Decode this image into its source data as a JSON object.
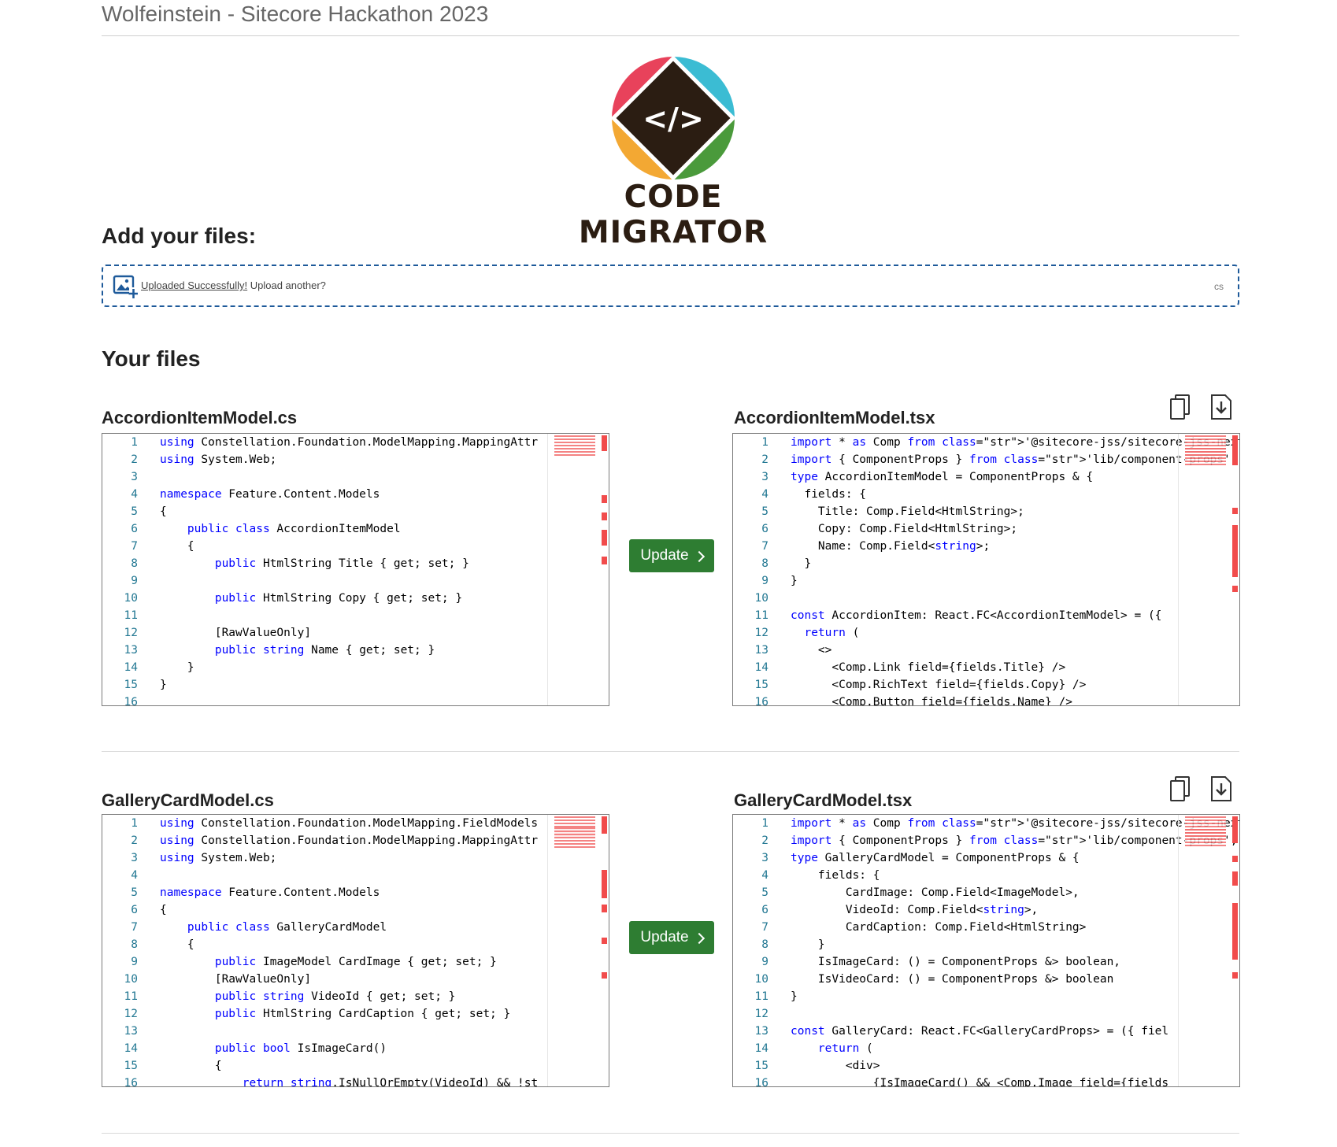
{
  "header": {
    "title": "Wolfeinstein - Sitecore Hackathon 2023"
  },
  "logo": {
    "text": "CODE MIGRATOR",
    "glyph": "</>",
    "colors": [
      "#e8425b",
      "#3bbcd3",
      "#f3a833",
      "#4a9a3b",
      "#2b1d12"
    ]
  },
  "upload": {
    "heading": "Add your files:",
    "link_text": "Uploaded Successfully!",
    "trailing_text": " Upload another?",
    "extension": "cs",
    "icon": "image-upload-icon"
  },
  "files_heading": "Your files",
  "update_label": "Update",
  "colors": {
    "accent": "#2e7d32",
    "dashed_border": "#1e5a9a",
    "error": "#f14c4c"
  },
  "pairs": [
    {
      "source": {
        "name": "AccordionItemModel.cs",
        "lines": [
          {
            "n": "1",
            "t": "using Constellation.Foundation.ModelMapping.MappingAttr"
          },
          {
            "n": "2",
            "t": "using System.Web;"
          },
          {
            "n": "3",
            "t": ""
          },
          {
            "n": "4",
            "t": "namespace Feature.Content.Models"
          },
          {
            "n": "5",
            "t": "{"
          },
          {
            "n": "6",
            "t": "    public class AccordionItemModel"
          },
          {
            "n": "7",
            "t": "    {"
          },
          {
            "n": "8",
            "t": "        public HtmlString Title { get; set; }"
          },
          {
            "n": "9",
            "t": ""
          },
          {
            "n": "10",
            "t": "        public HtmlString Copy { get; set; }"
          },
          {
            "n": "11",
            "t": ""
          },
          {
            "n": "12",
            "t": "        [RawValueOnly]"
          },
          {
            "n": "13",
            "t": "        public string Name { get; set; }"
          },
          {
            "n": "14",
            "t": "    }"
          },
          {
            "n": "15",
            "t": "}"
          },
          {
            "n": "16",
            "t": ""
          }
        ]
      },
      "target": {
        "name": "AccordionItemModel.tsx",
        "lines": [
          {
            "n": "1",
            "t": "import * as Comp from '@sitecore-jss/sitecore-jss-nextj"
          },
          {
            "n": "2",
            "t": "import { ComponentProps } from 'lib/component-props';"
          },
          {
            "n": "3",
            "t": "type AccordionItemModel = ComponentProps & {"
          },
          {
            "n": "4",
            "t": "  fields: {"
          },
          {
            "n": "5",
            "t": "    Title: Comp.Field<HtmlString>;"
          },
          {
            "n": "6",
            "t": "    Copy: Comp.Field<HtmlString>;"
          },
          {
            "n": "7",
            "t": "    Name: Comp.Field<string>;"
          },
          {
            "n": "8",
            "t": "  }"
          },
          {
            "n": "9",
            "t": "}"
          },
          {
            "n": "10",
            "t": ""
          },
          {
            "n": "11",
            "t": "const AccordionItem: React.FC<AccordionItemModel> = ({ "
          },
          {
            "n": "12",
            "t": "  return ("
          },
          {
            "n": "13",
            "t": "    <>"
          },
          {
            "n": "14",
            "t": "      <Comp.Link field={fields.Title} />"
          },
          {
            "n": "15",
            "t": "      <Comp.RichText field={fields.Copy} />"
          },
          {
            "n": "16",
            "t": "      <Comp.Button field={fields.Name} />"
          }
        ]
      }
    },
    {
      "source": {
        "name": "GalleryCardModel.cs",
        "lines": [
          {
            "n": "1",
            "t": "using Constellation.Foundation.ModelMapping.FieldModels"
          },
          {
            "n": "2",
            "t": "using Constellation.Foundation.ModelMapping.MappingAttr"
          },
          {
            "n": "3",
            "t": "using System.Web;"
          },
          {
            "n": "4",
            "t": ""
          },
          {
            "n": "5",
            "t": "namespace Feature.Content.Models"
          },
          {
            "n": "6",
            "t": "{"
          },
          {
            "n": "7",
            "t": "    public class GalleryCardModel"
          },
          {
            "n": "8",
            "t": "    {"
          },
          {
            "n": "9",
            "t": "        public ImageModel CardImage { get; set; }"
          },
          {
            "n": "10",
            "t": "        [RawValueOnly]"
          },
          {
            "n": "11",
            "t": "        public string VideoId { get; set; }"
          },
          {
            "n": "12",
            "t": "        public HtmlString CardCaption { get; set; }"
          },
          {
            "n": "13",
            "t": ""
          },
          {
            "n": "14",
            "t": "        public bool IsImageCard()"
          },
          {
            "n": "15",
            "t": "        {"
          },
          {
            "n": "16",
            "t": "            return string.IsNullOrEmpty(VideoId) && !st"
          }
        ]
      },
      "target": {
        "name": "GalleryCardModel.tsx",
        "lines": [
          {
            "n": "1",
            "t": "import * as Comp from '@sitecore-jss/sitecore-jss-nextj"
          },
          {
            "n": "2",
            "t": "import { ComponentProps } from 'lib/component-props';"
          },
          {
            "n": "3",
            "t": "type GalleryCardModel = ComponentProps & {"
          },
          {
            "n": "4",
            "t": "    fields: {"
          },
          {
            "n": "5",
            "t": "        CardImage: Comp.Field<ImageModel>,"
          },
          {
            "n": "6",
            "t": "        VideoId: Comp.Field<string>,"
          },
          {
            "n": "7",
            "t": "        CardCaption: Comp.Field<HtmlString>"
          },
          {
            "n": "8",
            "t": "    }"
          },
          {
            "n": "9",
            "t": "    IsImageCard: () = ComponentProps &> boolean,"
          },
          {
            "n": "10",
            "t": "    IsVideoCard: () = ComponentProps &> boolean"
          },
          {
            "n": "11",
            "t": "}"
          },
          {
            "n": "12",
            "t": ""
          },
          {
            "n": "13",
            "t": "const GalleryCard: React.FC<GalleryCardProps> = ({ fiel"
          },
          {
            "n": "14",
            "t": "    return ("
          },
          {
            "n": "15",
            "t": "        <div>"
          },
          {
            "n": "16",
            "t": "            {IsImageCard() && <Comp.Image field={fields"
          }
        ]
      }
    }
  ]
}
